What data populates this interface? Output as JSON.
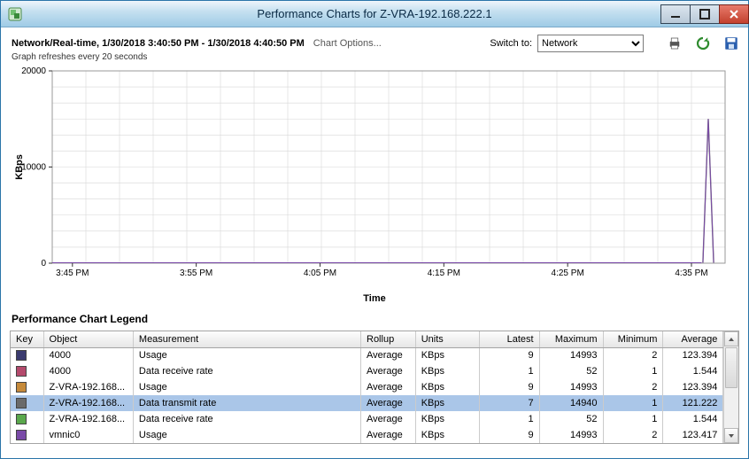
{
  "window": {
    "title": "Performance Charts for Z-VRA-192.168.222.1"
  },
  "header": {
    "range": "Network/Real-time, 1/30/2018 3:40:50 PM - 1/30/2018 4:40:50 PM",
    "chart_options_label": "Chart Options...",
    "switch_label": "Switch to:",
    "dropdown_selected": "Network",
    "refresh_note": "Graph refreshes every 20 seconds"
  },
  "chart_data": {
    "type": "line",
    "title": "",
    "xlabel": "Time",
    "ylabel": "KBps",
    "ylim": [
      0,
      20000
    ],
    "yticks": [
      0,
      10000,
      20000
    ],
    "categories": [
      "3:45 PM",
      "3:55 PM",
      "4:05 PM",
      "4:15 PM",
      "4:25 PM",
      "4:35 PM"
    ],
    "series": [
      {
        "name": "4000 Usage",
        "color": "#3a3a6e"
      },
      {
        "name": "4000 Data receive rate",
        "color": "#b44a6c"
      },
      {
        "name": "Z-VRA-192.168... Usage",
        "color": "#c68a3a"
      },
      {
        "name": "Z-VRA-192.168... Data transmit rate",
        "color": "#6a6a6a"
      },
      {
        "name": "Z-VRA-192.168... Data receive rate",
        "color": "#5aa84c"
      },
      {
        "name": "vmnic0 Usage",
        "color": "#7a4aa8"
      }
    ],
    "spike": {
      "x_fraction": 0.975,
      "peak_value": 14993
    }
  },
  "legend": {
    "title": "Performance Chart Legend",
    "columns": [
      "Key",
      "Object",
      "Measurement",
      "Rollup",
      "Units",
      "Latest",
      "Maximum",
      "Minimum",
      "Average"
    ],
    "selected_index": 3,
    "rows": [
      {
        "color": "#3a3a6e",
        "object": "4000",
        "measurement": "Usage",
        "rollup": "Average",
        "units": "KBps",
        "latest": 9,
        "maximum": 14993,
        "minimum": 2,
        "average": "123.394"
      },
      {
        "color": "#b44a6c",
        "object": "4000",
        "measurement": "Data receive rate",
        "rollup": "Average",
        "units": "KBps",
        "latest": 1,
        "maximum": 52,
        "minimum": 1,
        "average": "1.544"
      },
      {
        "color": "#c68a3a",
        "object": "Z-VRA-192.168...",
        "measurement": "Usage",
        "rollup": "Average",
        "units": "KBps",
        "latest": 9,
        "maximum": 14993,
        "minimum": 2,
        "average": "123.394"
      },
      {
        "color": "#6a6a6a",
        "object": "Z-VRA-192.168...",
        "measurement": "Data transmit rate",
        "rollup": "Average",
        "units": "KBps",
        "latest": 7,
        "maximum": 14940,
        "minimum": 1,
        "average": "121.222"
      },
      {
        "color": "#5aa84c",
        "object": "Z-VRA-192.168...",
        "measurement": "Data receive rate",
        "rollup": "Average",
        "units": "KBps",
        "latest": 1,
        "maximum": 52,
        "minimum": 1,
        "average": "1.544"
      },
      {
        "color": "#7a4aa8",
        "object": "vmnic0",
        "measurement": "Usage",
        "rollup": "Average",
        "units": "KBps",
        "latest": 9,
        "maximum": 14993,
        "minimum": 2,
        "average": "123.417"
      }
    ]
  }
}
